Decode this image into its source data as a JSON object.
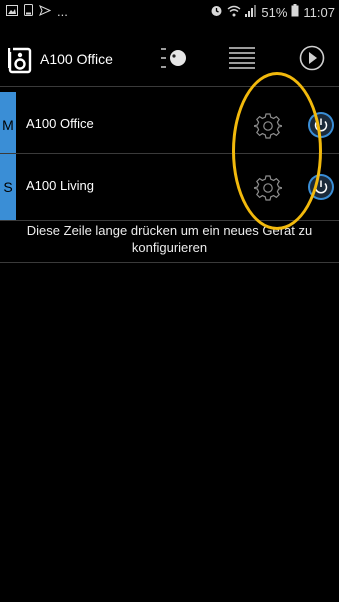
{
  "status_bar": {
    "left_icons": [
      "image-icon",
      "phone-icon",
      "send-icon"
    ],
    "ellipsis": "...",
    "battery": "51%",
    "time": "11:07"
  },
  "app_bar": {
    "device_name": "A100 Office",
    "icons": [
      "speaker-icon",
      "volume-knob-icon",
      "list-icon",
      "play-icon"
    ]
  },
  "devices": [
    {
      "tag": "M",
      "name": "A100 Office"
    },
    {
      "tag": "S",
      "name": "A100 Living"
    }
  ],
  "hint": "Diese Zeile lange drücken um ein neues Gerät zu konfigurieren",
  "colors": {
    "accent": "#3a8ed6",
    "annotation": "#f2b90c",
    "background": "#000000"
  }
}
